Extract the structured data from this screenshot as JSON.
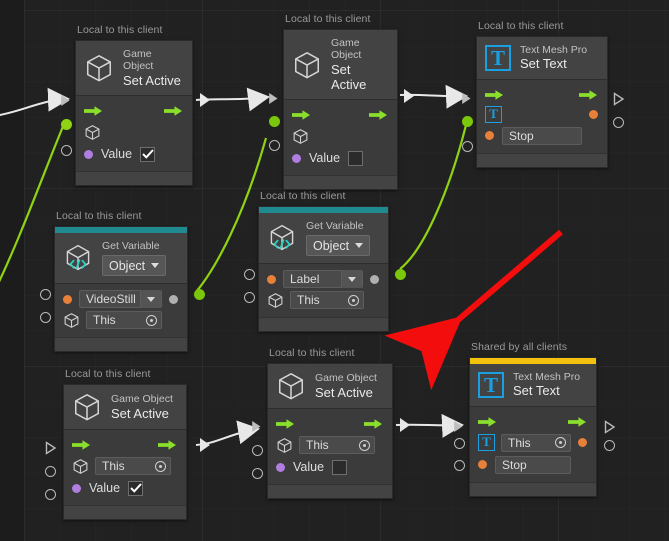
{
  "canvas": {
    "background": "#212121",
    "grid": true,
    "annotation_arrow_color": "#f40d0d",
    "flow_wire_color": "#e8e8e8",
    "data_wire_color": "#8fd312"
  },
  "labels": {
    "local": "Local to this client",
    "shared": "Shared by all clients"
  },
  "nodes": [
    {
      "id": "go-set-active-1",
      "tag": "Local to this client",
      "accent": null,
      "icon": "cube-icon",
      "title_sub": "Game Object",
      "title_main": "Set Active",
      "rows": [
        {
          "kind": "flow"
        },
        {
          "kind": "target",
          "icon": "cube-icon",
          "field": null
        },
        {
          "kind": "value",
          "dot": "purple",
          "label": "Value",
          "checked": true
        }
      ]
    },
    {
      "id": "go-set-active-2",
      "tag": "Local to this client",
      "accent": null,
      "icon": "cube-icon",
      "title_sub": "Game Object",
      "title_main": "Set Active",
      "rows": [
        {
          "kind": "flow"
        },
        {
          "kind": "target",
          "icon": "cube-icon",
          "field": null
        },
        {
          "kind": "value",
          "dot": "purple",
          "label": "Value",
          "checked": false
        }
      ]
    },
    {
      "id": "tmp-set-text-1",
      "tag": "Local to this client",
      "accent": null,
      "icon": "text-mesh-pro-icon",
      "title_sub": "Text Mesh Pro",
      "title_main": "Set Text",
      "rows": [
        {
          "kind": "flow"
        },
        {
          "kind": "tmp-target"
        },
        {
          "kind": "text-field",
          "dot": "orange",
          "value": "Stop"
        }
      ]
    },
    {
      "id": "get-variable-1",
      "tag": "Local to this client",
      "accent": "#1f8a8f",
      "icon": "cube-code-icon",
      "title_sub": "Get Variable",
      "title_main": "Object",
      "dropdown": "Object",
      "rows": [
        {
          "kind": "dropdown-field",
          "dot": "orange",
          "value": "VideoStill"
        },
        {
          "kind": "target-field",
          "icon": "cube-icon",
          "value": "This"
        }
      ]
    },
    {
      "id": "get-variable-2",
      "tag": "Local to this client",
      "accent": "#1f8a8f",
      "icon": "cube-code-icon",
      "title_sub": "Get Variable",
      "title_main": "Object",
      "dropdown": "Object",
      "rows": [
        {
          "kind": "dropdown-field",
          "dot": "orange",
          "value": "Label"
        },
        {
          "kind": "target-field",
          "icon": "cube-icon",
          "value": "This"
        }
      ]
    },
    {
      "id": "go-set-active-3",
      "tag": "Local to this client",
      "accent": null,
      "icon": "cube-icon",
      "title_sub": "Game Object",
      "title_main": "Set Active",
      "rows": [
        {
          "kind": "flow"
        },
        {
          "kind": "target-field",
          "icon": "cube-icon",
          "value": "This"
        },
        {
          "kind": "value",
          "dot": "purple",
          "label": "Value",
          "checked": true
        }
      ]
    },
    {
      "id": "go-set-active-4",
      "tag": "Local to this client",
      "accent": null,
      "icon": "cube-icon",
      "title_sub": "Game Object",
      "title_main": "Set Active",
      "rows": [
        {
          "kind": "flow"
        },
        {
          "kind": "target-field",
          "icon": "cube-icon",
          "value": "This"
        },
        {
          "kind": "value",
          "dot": "purple",
          "label": "Value",
          "checked": false
        }
      ]
    },
    {
      "id": "tmp-set-text-2",
      "tag": "Shared by all clients",
      "accent": "#f2c10d",
      "icon": "text-mesh-pro-icon",
      "title_sub": "Text Mesh Pro",
      "title_main": "Set Text",
      "rows": [
        {
          "kind": "flow"
        },
        {
          "kind": "tmp-target-field",
          "value": "This"
        },
        {
          "kind": "text-field",
          "dot": "orange",
          "value": "Stop"
        }
      ]
    }
  ],
  "values": {
    "this": "This",
    "stop": "Stop",
    "video_still": "VideoStill",
    "label": "Label",
    "object": "Object",
    "value": "Value",
    "game_object": "Game Object",
    "set_active": "Set Active",
    "text_mesh_pro": "Text Mesh Pro",
    "set_text": "Set Text",
    "get_variable": "Get Variable"
  }
}
